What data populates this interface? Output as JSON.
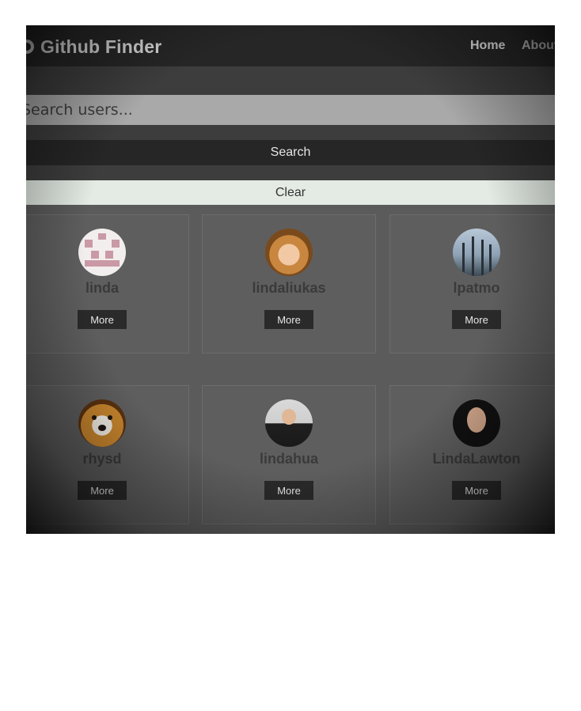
{
  "navbar": {
    "brand": "Github Finder",
    "links": [
      "Home",
      "About"
    ]
  },
  "search": {
    "placeholder": "Search users...",
    "search_label": "Search",
    "clear_label": "Clear"
  },
  "users": [
    {
      "login": "linda",
      "more_label": "More"
    },
    {
      "login": "lindaliukas",
      "more_label": "More"
    },
    {
      "login": "lpatmo",
      "more_label": "More"
    },
    {
      "login": "rhysd",
      "more_label": "More"
    },
    {
      "login": "lindahua",
      "more_label": "More"
    },
    {
      "login": "LindaLawton",
      "more_label": "More"
    }
  ]
}
